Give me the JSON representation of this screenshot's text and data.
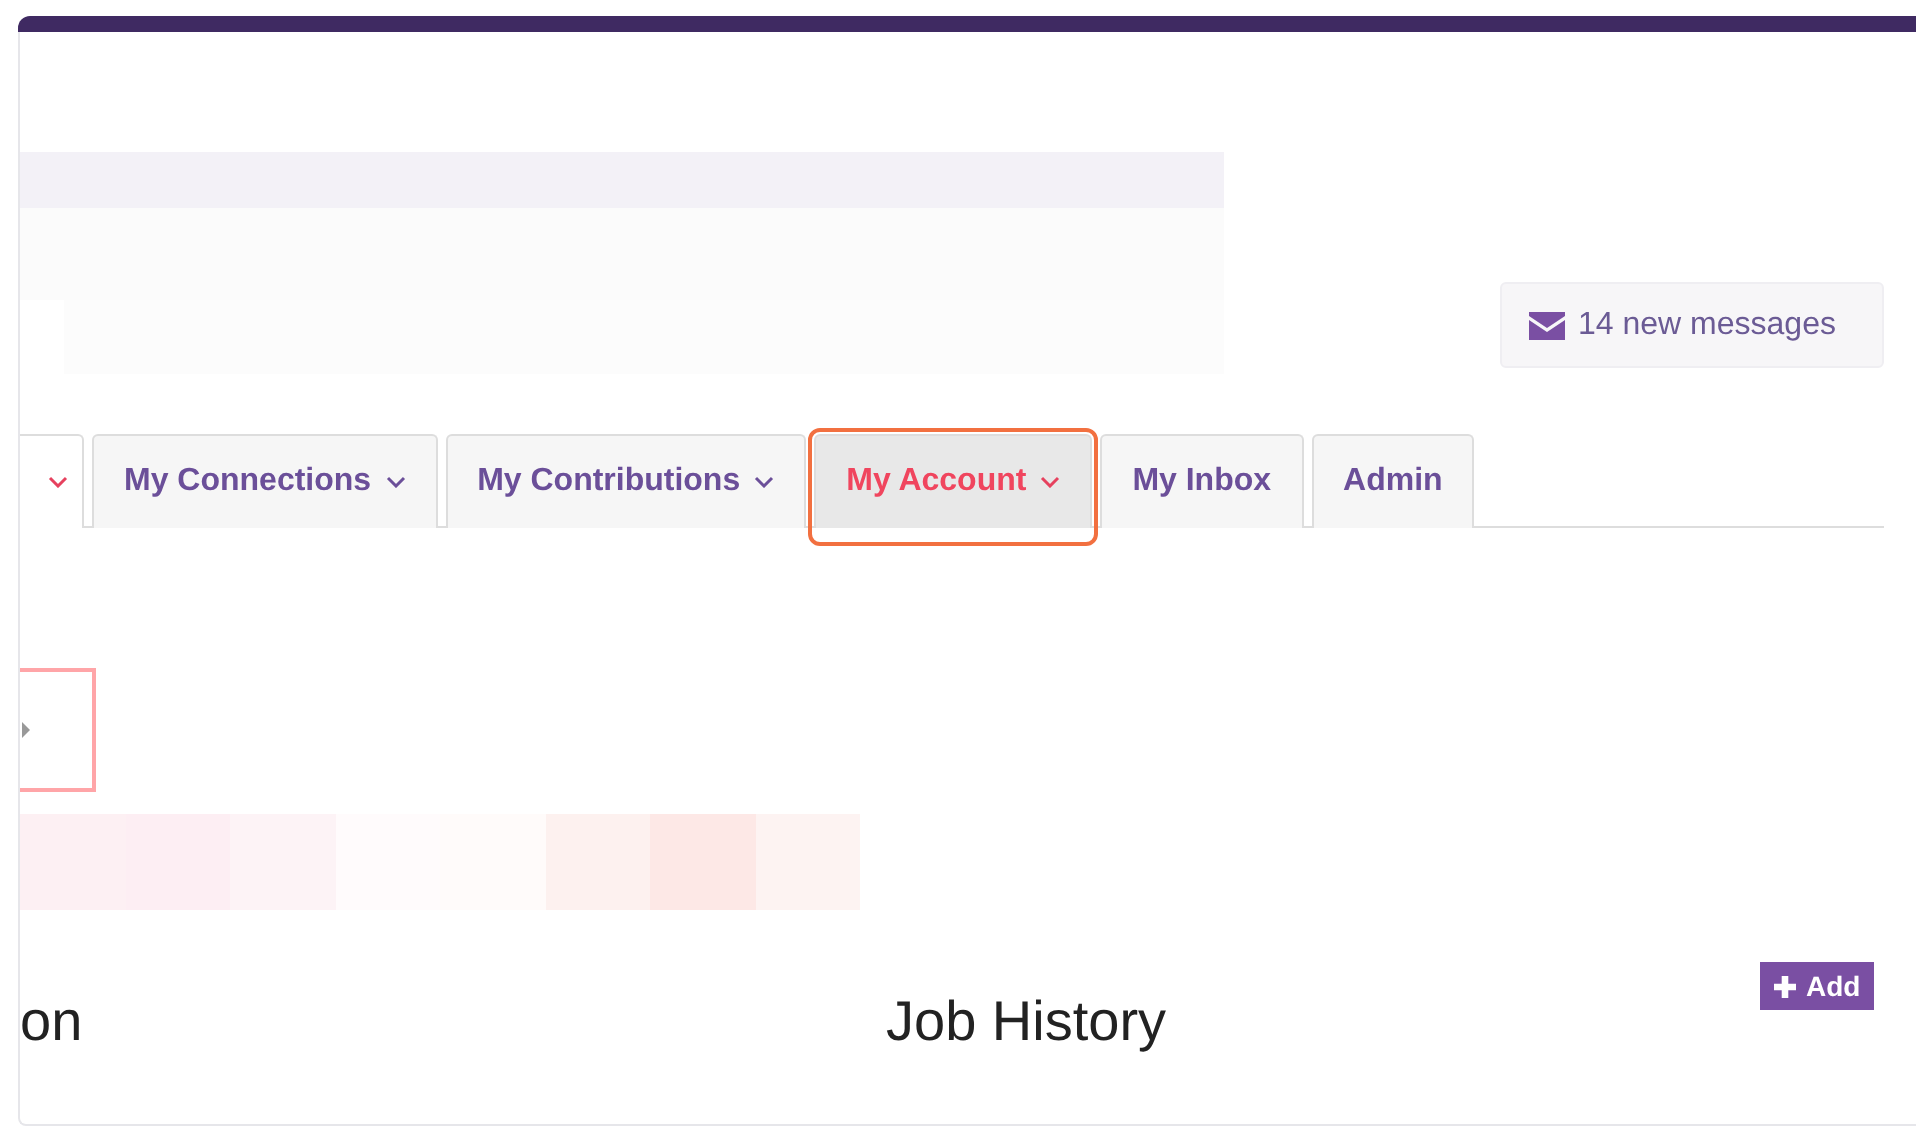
{
  "messages_button": {
    "label": "14 new messages"
  },
  "tabs": [
    {
      "dropdown": true,
      "selected": true,
      "hovered": false,
      "highlighted": false
    },
    {
      "label": "My Connections",
      "dropdown": true,
      "selected": false,
      "hovered": false,
      "highlighted": false
    },
    {
      "label": "My Contributions",
      "dropdown": true,
      "selected": false,
      "hovered": false,
      "highlighted": false
    },
    {
      "label": "My Account",
      "dropdown": true,
      "selected": false,
      "hovered": true,
      "highlighted": true
    },
    {
      "label": "My Inbox",
      "dropdown": false,
      "selected": false,
      "hovered": false,
      "highlighted": false
    },
    {
      "label": "Admin",
      "dropdown": false,
      "selected": false,
      "hovered": false,
      "highlighted": false
    }
  ],
  "sections": [
    {
      "heading": "on"
    },
    {
      "heading": "Job History",
      "add_button": "Add"
    }
  ]
}
